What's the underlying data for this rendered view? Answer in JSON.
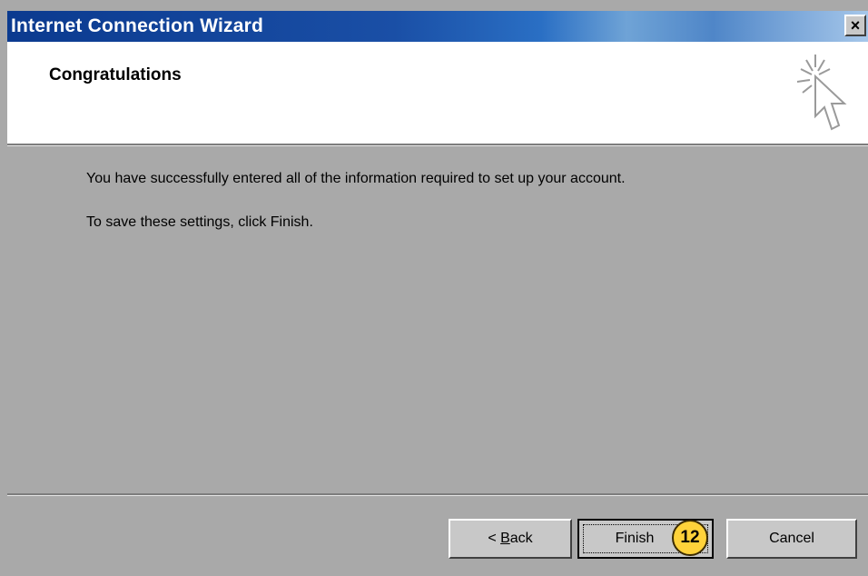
{
  "window": {
    "title": "Internet Connection Wizard",
    "close_label": "×"
  },
  "header": {
    "title": "Congratulations",
    "icon": "wizard-cursor-icon"
  },
  "content": {
    "line1": "You have successfully entered all of the information required to set up your account.",
    "line2": "To save these settings, click Finish."
  },
  "buttons": {
    "back_prefix": "< ",
    "back_mnemonic": "B",
    "back_rest": "ack",
    "finish_label": "Finish",
    "cancel_label": "Cancel"
  },
  "annotation": {
    "step_number": "12"
  },
  "colors": {
    "titlebar_start": "#0b3a8f",
    "titlebar_end": "#a6c7ea",
    "dialog_bg": "#a9a9a9",
    "header_bg": "#ffffff",
    "badge": "#ffd23a"
  }
}
